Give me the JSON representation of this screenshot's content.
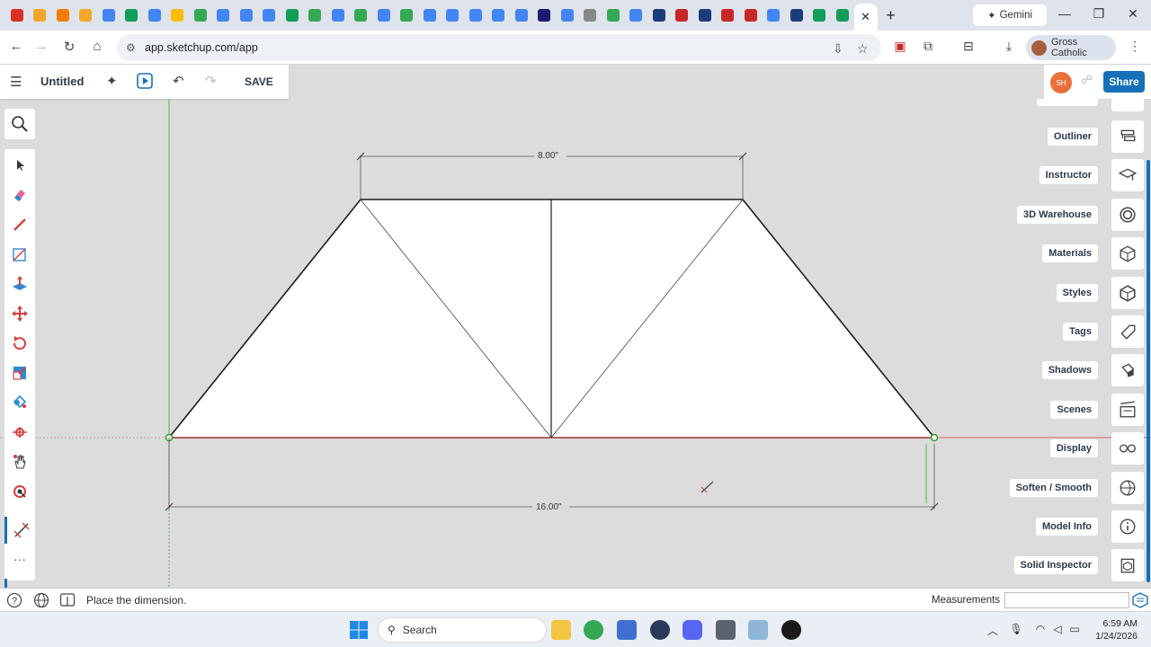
{
  "browser": {
    "tab_favicon_colors": [
      "#d93025",
      "#f4a62a",
      "#f57c00",
      "#f4a62a",
      "#4285f4",
      "#0f9d58",
      "#4285f4",
      "#fbbc04",
      "#34a853",
      "#4285f4",
      "#4285f4",
      "#4285f4",
      "#0f9d58",
      "#34a853",
      "#4285f4",
      "#34a853",
      "#4285f4",
      "#34a853",
      "#4285f4",
      "#4285f4",
      "#4285f4",
      "#4285f4",
      "#4285f4",
      "#1a1a6e",
      "#4285f4",
      "#888888",
      "#34a853",
      "#4285f4",
      "#1a3c7a",
      "#c62828",
      "#1a3c7a",
      "#c62828",
      "#c62828",
      "#4285f4",
      "#1a3c7a",
      "#0f9d58",
      "#0f9d58"
    ],
    "active_tab_close": "✕",
    "new_tab": "+",
    "gemini_tab": "Gemini",
    "url": "app.sketchup.com/app",
    "profile_name": "Gross Catholic"
  },
  "app": {
    "title": "Untitled",
    "save_label": "SAVE",
    "avatar_initials": "SH",
    "share_label": "Share"
  },
  "drawing": {
    "top_dimension": "8.00\"",
    "bottom_dimension": "16.00\""
  },
  "right_panels": [
    {
      "label": "Outliner",
      "icon": "outliner-icon"
    },
    {
      "label": "Instructor",
      "icon": "instructor-icon"
    },
    {
      "label": "3D Warehouse",
      "icon": "warehouse-icon"
    },
    {
      "label": "Materials",
      "icon": "materials-icon"
    },
    {
      "label": "Styles",
      "icon": "styles-icon"
    },
    {
      "label": "Tags",
      "icon": "tags-icon"
    },
    {
      "label": "Shadows",
      "icon": "shadows-icon"
    },
    {
      "label": "Scenes",
      "icon": "scenes-icon"
    },
    {
      "label": "Display",
      "icon": "display-icon"
    },
    {
      "label": "Soften / Smooth",
      "icon": "soften-icon"
    },
    {
      "label": "Model Info",
      "icon": "info-icon"
    },
    {
      "label": "Solid Inspector",
      "icon": "solid-inspector-icon"
    }
  ],
  "status": {
    "message": "Place the dimension.",
    "measurements_label": "Measurements",
    "measurements_value": ""
  },
  "taskbar": {
    "search_label": "Search",
    "time": "6:59 AM",
    "date": "1/24/2026"
  }
}
